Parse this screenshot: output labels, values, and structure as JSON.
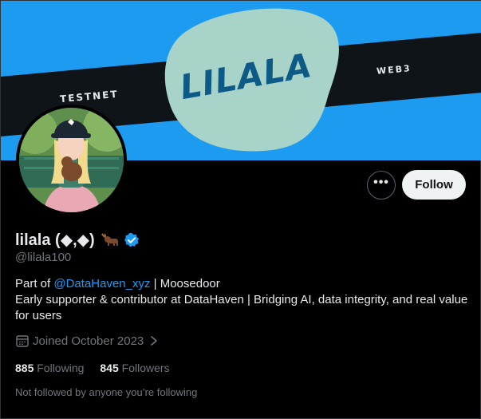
{
  "banner": {
    "title": "LILALA",
    "left_tag": "TESTNET",
    "right_tag": "WEB3",
    "colors": {
      "background": "#1d9bf0",
      "stripe": "#0f1419",
      "blob": "#a7d3c8",
      "title": "#0e5a86"
    }
  },
  "profile": {
    "name": "lilala (◆,◆)",
    "handle": "@lilala100",
    "bio_prefix": "Part of ",
    "bio_mention": "@DataHaven_xyz",
    "bio_suffix": " | Moosedoor",
    "bio_line2": "Early supporter & contributor at DataHaven | Bridging AI, data integrity, and real value for users",
    "joined": "Joined October 2023",
    "following_count": "885",
    "following_label": "Following",
    "followers_count": "845",
    "followers_label": "Followers",
    "not_followed_text": "Not followed by anyone you’re following"
  },
  "actions": {
    "more_label": "•••",
    "follow_label": "Follow"
  },
  "icons": {
    "more": "more-icon",
    "verified": "verified-badge-icon",
    "moose": "moose-emoji-icon",
    "calendar": "calendar-icon",
    "chevron": "chevron-right-icon"
  },
  "colors": {
    "accent": "#1d9bf0",
    "text": "#e7e9ea",
    "muted": "#71767b",
    "background": "#000000"
  }
}
